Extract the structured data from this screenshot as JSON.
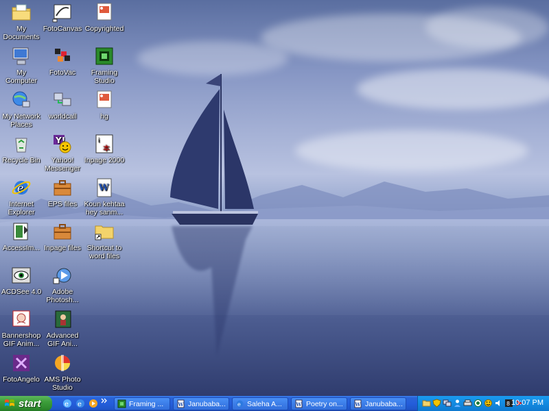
{
  "desktop": {
    "icons": [
      {
        "label": "My Documents",
        "icon": "folder-documents-icon"
      },
      {
        "label": "FotoCanvas",
        "icon": "fotocanvas-icon"
      },
      {
        "label": "Copyrighted",
        "icon": "image-file-icon"
      },
      {
        "label": "My Computer",
        "icon": "computer-icon"
      },
      {
        "label": "FotoVac",
        "icon": "fotovac-icon"
      },
      {
        "label": "Framing Studio",
        "icon": "framing-studio-icon"
      },
      {
        "label": "My Network Places",
        "icon": "network-places-icon"
      },
      {
        "label": "worldcall",
        "icon": "network-connection-icon"
      },
      {
        "label": "hg",
        "icon": "image-file-icon"
      },
      {
        "label": "Recycle Bin",
        "icon": "recycle-bin-icon"
      },
      {
        "label": "Yahoo! Messenger",
        "icon": "yahoo-messenger-icon"
      },
      {
        "label": "Inpage 2000",
        "icon": "inpage-icon"
      },
      {
        "label": "Internet Explorer",
        "icon": "internet-explorer-icon"
      },
      {
        "label": "EPS files",
        "icon": "briefcase-icon"
      },
      {
        "label": "Koun kehtaa hey sanm...",
        "icon": "word-document-icon"
      },
      {
        "label": "AccessIm...",
        "icon": "access-image-icon"
      },
      {
        "label": "Inpage files",
        "icon": "briefcase-icon"
      },
      {
        "label": "Shortcut to word files",
        "icon": "folder-shortcut-icon"
      },
      {
        "label": "ACDSee 4.0",
        "icon": "acdsee-icon"
      },
      {
        "label": "Adobe Photosh...",
        "icon": "photoshop-icon"
      },
      {
        "label": "Bannershop GIF Anim...",
        "icon": "bannershop-icon"
      },
      {
        "label": "Advanced GIF Ani...",
        "icon": "advanced-gif-icon"
      },
      {
        "label": "FotoAngelo",
        "icon": "fotoangelo-icon"
      },
      {
        "label": "AMS Photo Studio",
        "icon": "ams-photo-studio-icon"
      }
    ]
  },
  "taskbar": {
    "start_label": "start",
    "tasks": [
      {
        "label": "Framing ...",
        "icon": "framing-studio-icon"
      },
      {
        "label": "Janubaba...",
        "icon": "word-document-icon"
      },
      {
        "label": "Saleha A...",
        "icon": "internet-explorer-icon"
      },
      {
        "label": "Poetry on...",
        "icon": "word-document-icon"
      },
      {
        "label": "Janubaba...",
        "icon": "word-document-icon"
      }
    ],
    "clock": "10:07 PM"
  },
  "colors": {
    "taskbar_blue": "#245edb",
    "start_green": "#3c9d3a",
    "tray_blue": "#138ae0"
  }
}
